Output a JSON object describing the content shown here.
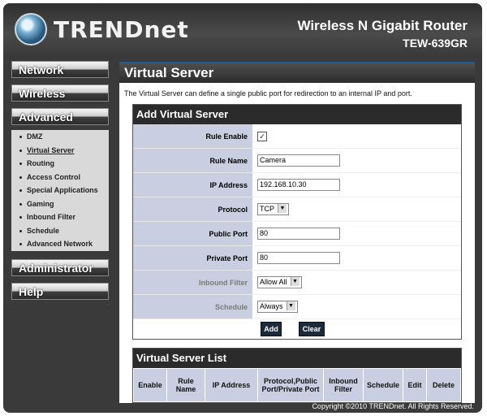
{
  "brand": {
    "logo_text": "TRENDnet",
    "product_name": "Wireless N Gigabit Router",
    "model": "TEW-639GR"
  },
  "sidebar": {
    "network": "Network",
    "wireless": "Wireless",
    "advanced": "Advanced",
    "advanced_items": [
      "DMZ",
      "Virtual Server",
      "Routing",
      "Access Control",
      "Special Applications",
      "Gaming",
      "Inbound Filter",
      "Schedule",
      "Advanced Network"
    ],
    "administrator": "Administrator",
    "help": "Help"
  },
  "main": {
    "title": "Virtual Server",
    "description": "The Virtual Server can define a single public port for redirection to an internal IP and port."
  },
  "form": {
    "heading": "Add Virtual Server",
    "rule_enable_label": "Rule Enable",
    "rule_enable_checked": true,
    "rule_name_label": "Rule Name",
    "rule_name_value": "Camera",
    "ip_label": "IP Address",
    "ip_value": "192.168.10.30",
    "protocol_label": "Protocol",
    "protocol_value": "TCP",
    "public_port_label": "Public Port",
    "public_port_value": "80",
    "private_port_label": "Private Port",
    "private_port_value": "80",
    "inbound_filter_label": "Inbound Filter",
    "inbound_filter_value": "Allow All",
    "schedule_label": "Schedule",
    "schedule_value": "Always",
    "add_button": "Add",
    "clear_button": "Clear"
  },
  "list": {
    "heading": "Virtual Server List",
    "columns": [
      "Enable",
      "Rule Name",
      "IP Address",
      "Protocol,Public Port/Private Port",
      "Inbound Filter",
      "Schedule",
      "Edit",
      "Delete"
    ]
  },
  "footer": {
    "copyright": "Copyright ©2010 TRENDnet. All Rights Reserved."
  }
}
